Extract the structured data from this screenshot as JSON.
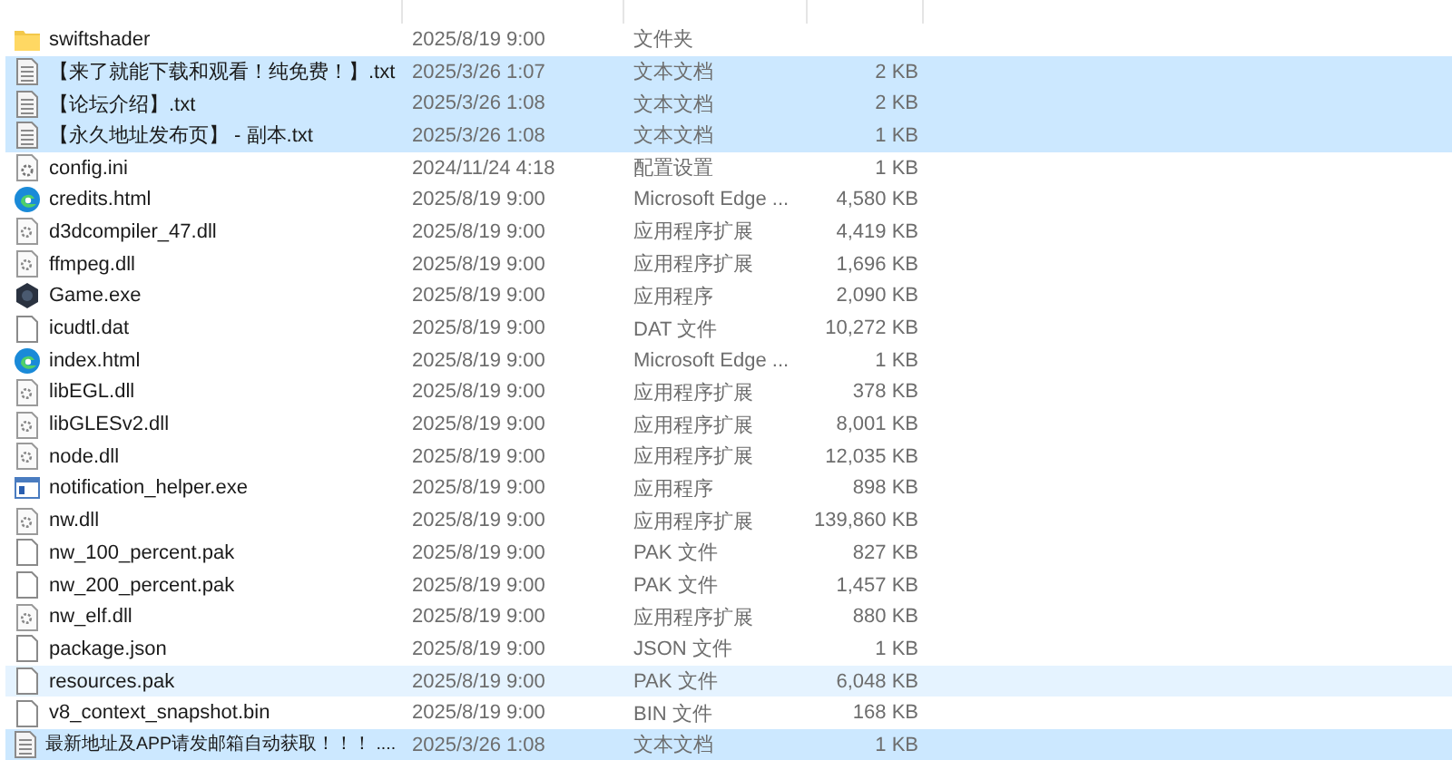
{
  "files": [
    {
      "name": "swiftshader",
      "date": "2025/8/19 9:00",
      "type": "文件夹",
      "kind": "folder",
      "selected": false,
      "hovered": false
    },
    {
      "name": "【来了就能下载和观看！纯免费！】.txt",
      "date": "2025/3/26 1:07",
      "type": "文本文档",
      "size": "2 KB",
      "kind": "text",
      "selected": true,
      "hovered": false
    },
    {
      "name": "【论坛介绍】.txt",
      "date": "2025/3/26 1:08",
      "type": "文本文档",
      "size": "2 KB",
      "kind": "text",
      "selected": true,
      "hovered": false
    },
    {
      "name": "【永久地址发布页】 - 副本.txt",
      "date": "2025/3/26 1:08",
      "type": "文本文档",
      "size": "1 KB",
      "kind": "text",
      "selected": true,
      "hovered": false
    },
    {
      "name": "config.ini",
      "date": "2024/11/24 4:18",
      "type": "配置设置",
      "size": "1 KB",
      "kind": "config",
      "selected": false,
      "hovered": false
    },
    {
      "name": "credits.html",
      "date": "2025/8/19 9:00",
      "type": "Microsoft Edge ...",
      "size": "4,580 KB",
      "kind": "edge",
      "selected": false,
      "hovered": false
    },
    {
      "name": "d3dcompiler_47.dll",
      "date": "2025/8/19 9:00",
      "type": "应用程序扩展",
      "size": "4,419 KB",
      "kind": "dll",
      "selected": false,
      "hovered": false
    },
    {
      "name": "ffmpeg.dll",
      "date": "2025/8/19 9:00",
      "type": "应用程序扩展",
      "size": "1,696 KB",
      "kind": "dll",
      "selected": false,
      "hovered": false
    },
    {
      "name": "Game.exe",
      "date": "2025/8/19 9:00",
      "type": "应用程序",
      "size": "2,090 KB",
      "kind": "game",
      "selected": false,
      "hovered": false
    },
    {
      "name": "icudtl.dat",
      "date": "2025/8/19 9:00",
      "type": "DAT 文件",
      "size": "10,272 KB",
      "kind": "blank",
      "selected": false,
      "hovered": false
    },
    {
      "name": "index.html",
      "date": "2025/8/19 9:00",
      "type": "Microsoft Edge ...",
      "size": "1 KB",
      "kind": "edge",
      "selected": false,
      "hovered": false
    },
    {
      "name": "libEGL.dll",
      "date": "2025/8/19 9:00",
      "type": "应用程序扩展",
      "size": "378 KB",
      "kind": "dll",
      "selected": false,
      "hovered": false
    },
    {
      "name": "libGLESv2.dll",
      "date": "2025/8/19 9:00",
      "type": "应用程序扩展",
      "size": "8,001 KB",
      "kind": "dll",
      "selected": false,
      "hovered": false
    },
    {
      "name": "node.dll",
      "date": "2025/8/19 9:00",
      "type": "应用程序扩展",
      "size": "12,035 KB",
      "kind": "dll",
      "selected": false,
      "hovered": false
    },
    {
      "name": "notification_helper.exe",
      "date": "2025/8/19 9:00",
      "type": "应用程序",
      "size": "898 KB",
      "kind": "app",
      "selected": false,
      "hovered": false
    },
    {
      "name": "nw.dll",
      "date": "2025/8/19 9:00",
      "type": "应用程序扩展",
      "size": "139,860 KB",
      "kind": "dll",
      "selected": false,
      "hovered": false
    },
    {
      "name": "nw_100_percent.pak",
      "date": "2025/8/19 9:00",
      "type": "PAK 文件",
      "size": "827 KB",
      "kind": "blank",
      "selected": false,
      "hovered": false
    },
    {
      "name": "nw_200_percent.pak",
      "date": "2025/8/19 9:00",
      "type": "PAK 文件",
      "size": "1,457 KB",
      "kind": "blank",
      "selected": false,
      "hovered": false
    },
    {
      "name": "nw_elf.dll",
      "date": "2025/8/19 9:00",
      "type": "应用程序扩展",
      "size": "880 KB",
      "kind": "dll",
      "selected": false,
      "hovered": false
    },
    {
      "name": "package.json",
      "date": "2025/8/19 9:00",
      "type": "JSON 文件",
      "size": "1 KB",
      "kind": "blank",
      "selected": false,
      "hovered": false
    },
    {
      "name": "resources.pak",
      "date": "2025/8/19 9:00",
      "type": "PAK 文件",
      "size": "6,048 KB",
      "kind": "blank",
      "selected": false,
      "hovered": true
    },
    {
      "name": "v8_context_snapshot.bin",
      "date": "2025/8/19 9:00",
      "type": "BIN 文件",
      "size": "168 KB",
      "kind": "blank",
      "selected": false,
      "hovered": false
    },
    {
      "name": "最新地址及APP请发邮箱自动获取！！！ ....",
      "date": "2025/3/26 1:08",
      "type": "文本文档",
      "size": "1 KB",
      "kind": "text",
      "selected": true,
      "hovered": false
    }
  ]
}
